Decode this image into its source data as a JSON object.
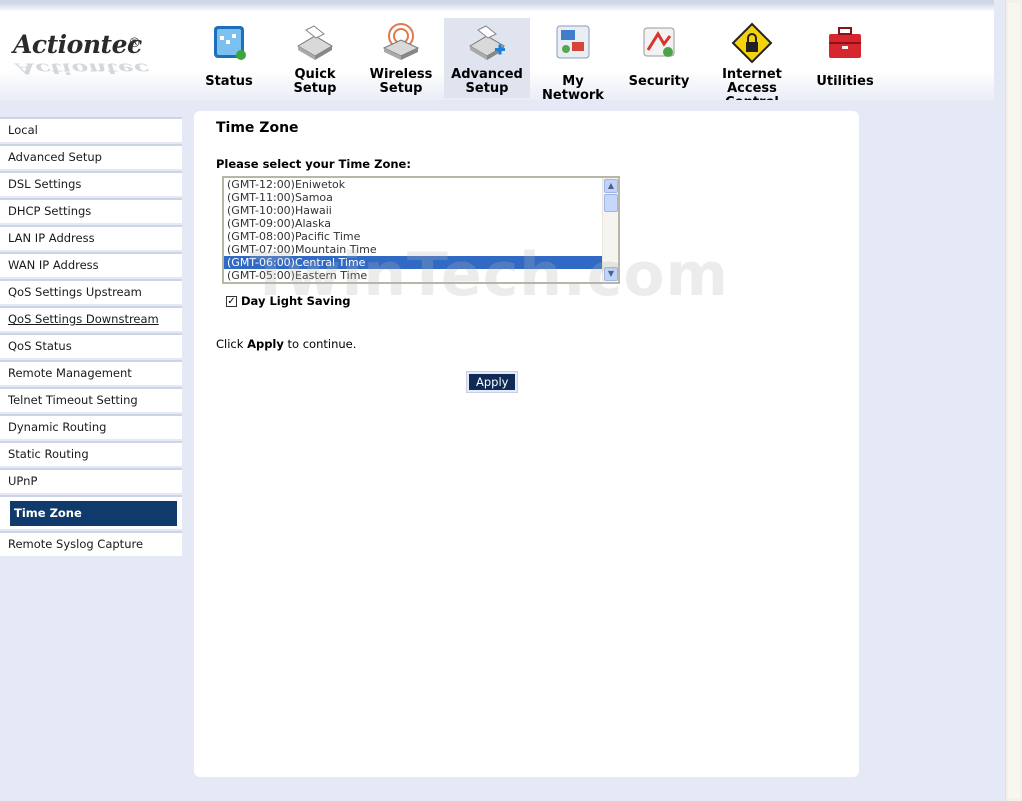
{
  "logo": {
    "brand": "Actiontec",
    "reg_mark": "®"
  },
  "nav": {
    "tabs": [
      {
        "label": "Status",
        "icon": "status-icon"
      },
      {
        "label": "Quick Setup",
        "icon": "quick-setup-icon"
      },
      {
        "label": "Wireless Setup",
        "icon": "wireless-icon"
      },
      {
        "label": "Advanced Setup",
        "icon": "advanced-setup-icon",
        "active": true
      },
      {
        "label": "My Network",
        "icon": "my-network-icon"
      },
      {
        "label": "Security",
        "icon": "security-icon"
      },
      {
        "label": "Internet Access Control",
        "icon": "lock-icon"
      },
      {
        "label": "Utilities",
        "icon": "toolbox-icon"
      }
    ]
  },
  "sidebar": {
    "items": [
      {
        "label": "Local"
      },
      {
        "label": "Advanced Setup"
      },
      {
        "label": "DSL Settings"
      },
      {
        "label": "DHCP Settings"
      },
      {
        "label": "LAN IP Address"
      },
      {
        "label": "WAN IP Address"
      },
      {
        "label": "QoS Settings Upstream"
      },
      {
        "label": "QoS Settings Downstream"
      },
      {
        "label": "QoS Status"
      },
      {
        "label": "Remote Management"
      },
      {
        "label": "Telnet Timeout Setting"
      },
      {
        "label": "Dynamic Routing"
      },
      {
        "label": "Static Routing"
      },
      {
        "label": "UPnP"
      },
      {
        "label": "Time Zone",
        "active": true
      },
      {
        "label": "Remote Syslog Capture"
      }
    ]
  },
  "main": {
    "title": "Time Zone",
    "prompt": "Please select your Time Zone:",
    "timezones": [
      "(GMT-12:00)Eniwetok",
      "(GMT-11:00)Samoa",
      "(GMT-10:00)Hawaii",
      "(GMT-09:00)Alaska",
      "(GMT-08:00)Pacific Time",
      "(GMT-07:00)Mountain Time",
      "(GMT-06:00)Central Time",
      "(GMT-05:00)Eastern Time"
    ],
    "selected_timezone": "(GMT-06:00)Central Time",
    "daylight_saving_label": "Day Light Saving",
    "daylight_saving_checked": true,
    "hint_prefix": "Click ",
    "hint_bold": "Apply",
    "hint_suffix": " to continue.",
    "apply_label": "Apply"
  },
  "watermark": "TwinTech.com",
  "colors": {
    "selected_row": "#316ac5",
    "active_sidebar": "#0f3a6b",
    "apply_button": "#0f2a57",
    "frame_background": "#e4e9f5"
  }
}
